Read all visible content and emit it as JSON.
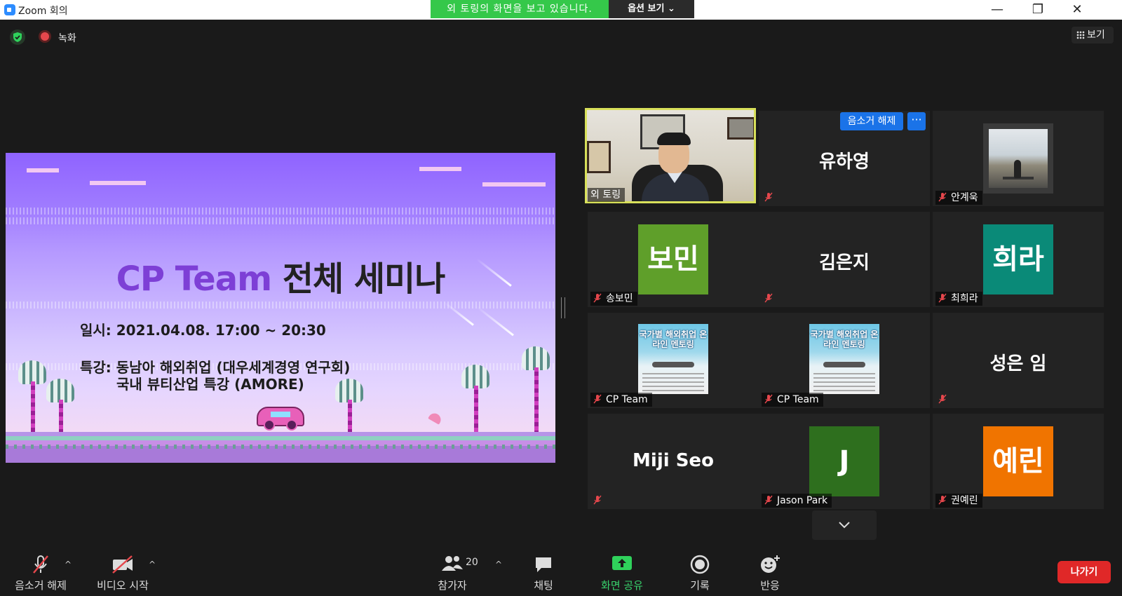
{
  "window": {
    "title": "Zoom 회의",
    "share_banner": "외 토링의 화면을 보고 있습니다.",
    "view_options": "옵션 보기 ⌄",
    "controls": [
      "—",
      "❐",
      "✕"
    ]
  },
  "top": {
    "recording_label": "녹화",
    "view_label": "보기"
  },
  "slide": {
    "title_en": "CP Team",
    "title_ko": "전체 세미나",
    "date_line": "일시: 2021.04.08. 17:00 ~ 20:30",
    "lecture_line1": "특강: 동남아 해외취업 (대우세계경영 연구회)",
    "lecture_line2": "국내 뷰티산업 특강 (AMORE)"
  },
  "participants": [
    {
      "name": "외 토링",
      "type": "video"
    },
    {
      "name": "유하영",
      "type": "name",
      "display": "유하영"
    },
    {
      "name": "안계욱",
      "type": "photo"
    },
    {
      "name": "송보민",
      "type": "avatar",
      "initials": "보민",
      "color": "#5F9F2A"
    },
    {
      "name": "",
      "type": "name",
      "display": "김은지"
    },
    {
      "name": "최희라",
      "type": "avatar",
      "initials": "희라",
      "color": "#0A8A78"
    },
    {
      "name": "CP Team",
      "type": "poster",
      "poster_text": "국가별 해외취업 온라인 멘토링"
    },
    {
      "name": "CP Team",
      "type": "poster",
      "poster_text": "국가별 해외취업 온라인 멘토링"
    },
    {
      "name": "",
      "type": "name",
      "display": "성은 임"
    },
    {
      "name": "",
      "type": "name",
      "display": "Miji Seo"
    },
    {
      "name": "Jason Park",
      "type": "avatar",
      "initials": "J",
      "color": "#2E6F1E"
    },
    {
      "name": "권예린",
      "type": "avatar",
      "initials": "예린",
      "color": "#F07400"
    }
  ],
  "tile_actions": {
    "unmute_label": "음소거 해제",
    "more_label": "···"
  },
  "toolbar": {
    "unmute_label": "음소거 해제",
    "video_label": "비디오 시작",
    "participants_label": "참가자",
    "participants_count": "20",
    "chat_label": "채팅",
    "share_label": "화면 공유",
    "record_label": "기록",
    "reactions_label": "반응",
    "leave_label": "나가기"
  },
  "colors": {
    "accent": "#2D8CFF",
    "share_green": "#35C84A",
    "active_speaker": "#D8E05A",
    "leave_red": "#E02828"
  }
}
